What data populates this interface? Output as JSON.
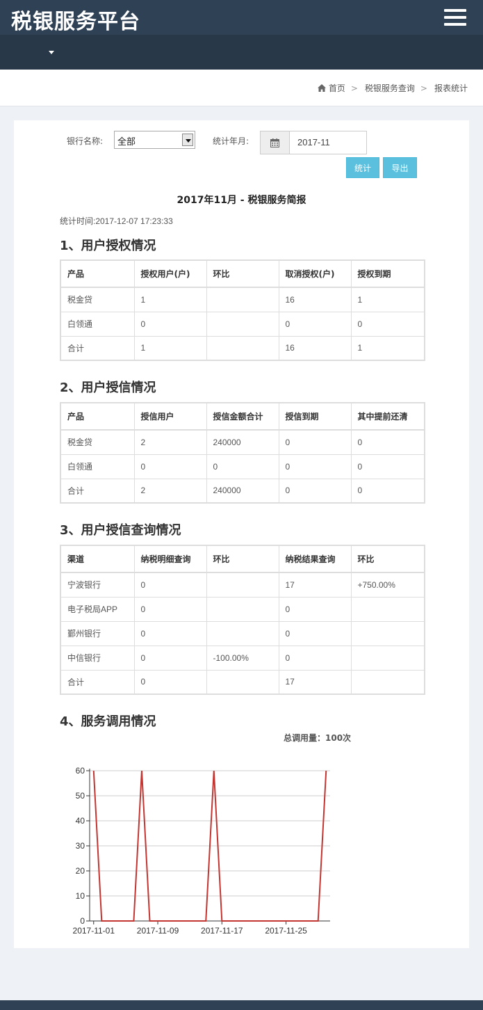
{
  "header": {
    "app_title": "税银服务平台",
    "menu_icon": "hamburger-icon"
  },
  "breadcrumb": {
    "items": [
      "首页",
      "税银服务查询",
      "报表统计"
    ],
    "home_icon": "home-icon"
  },
  "filters": {
    "bank_label": "银行名称:",
    "bank_value": "全部",
    "month_label": "统计年月:",
    "month_value": "2017-11",
    "calendar_icon": "calendar-icon",
    "stat_button": "统计",
    "export_button": "导出",
    "button_color": "#5bc0de"
  },
  "report": {
    "title": "2017年11月 - 税银服务简报",
    "stat_time": "统计时间:2017-12-07 17:23:33"
  },
  "sections": {
    "auth": {
      "title": "1、用户授权情况",
      "headers": [
        "产品",
        "授权用户(户)",
        "环比",
        "取消授权(户)",
        "授权到期"
      ],
      "rows": [
        [
          "税金贷",
          "1",
          "",
          "16",
          "1"
        ],
        [
          "白领通",
          "0",
          "",
          "0",
          "0"
        ],
        [
          "合计",
          "1",
          "",
          "16",
          "1"
        ]
      ]
    },
    "credit": {
      "title": "2、用户授信情况",
      "headers": [
        "产品",
        "授信用户",
        "授信金额合计",
        "授信到期",
        "其中提前还清"
      ],
      "rows": [
        [
          "税金贷",
          "2",
          "240000",
          "0",
          "0"
        ],
        [
          "白领通",
          "0",
          "0",
          "0",
          "0"
        ],
        [
          "合计",
          "2",
          "240000",
          "0",
          "0"
        ]
      ]
    },
    "query": {
      "title": "3、用户授信查询情况",
      "headers": [
        "渠道",
        "纳税明细查询",
        "环比",
        "纳税结果查询",
        "环比"
      ],
      "rows": [
        [
          "宁波银行",
          "0",
          "",
          "17",
          "+750.00%"
        ],
        [
          "电子税局APP",
          "0",
          "",
          "0",
          ""
        ],
        [
          "鄞州银行",
          "0",
          "",
          "0",
          ""
        ],
        [
          "中信银行",
          "0",
          "-100.00%",
          "0",
          ""
        ],
        [
          "合计",
          "0",
          "",
          "17",
          ""
        ]
      ]
    },
    "service": {
      "title": "4、服务调用情况",
      "total": "总调用量：100次"
    }
  },
  "chart_data": {
    "type": "line",
    "title": "",
    "xlabel": "",
    "ylabel": "",
    "ylim": [
      0,
      60
    ],
    "yticks": [
      "0",
      "10",
      "20",
      "30",
      "40",
      "50",
      "60"
    ],
    "xtick_labels": [
      "2017-11-01",
      "2017-11-09",
      "2017-11-17",
      "2017-11-25"
    ],
    "grid": true,
    "line_color": "#c23531",
    "series": [
      {
        "x": [
          "2017-11-01",
          "2017-11-02",
          "2017-11-03",
          "2017-11-04",
          "2017-11-05",
          "2017-11-06",
          "2017-11-07",
          "2017-11-08",
          "2017-11-09",
          "2017-11-10",
          "2017-11-11",
          "2017-11-12",
          "2017-11-13",
          "2017-11-14",
          "2017-11-15",
          "2017-11-16",
          "2017-11-17",
          "2017-11-18",
          "2017-11-19",
          "2017-11-20",
          "2017-11-21",
          "2017-11-22",
          "2017-11-23",
          "2017-11-24",
          "2017-11-25",
          "2017-11-26",
          "2017-11-27",
          "2017-11-28",
          "2017-11-29",
          "2017-11-30"
        ],
        "values": [
          60,
          0,
          0,
          0,
          0,
          0,
          60,
          0,
          0,
          0,
          0,
          0,
          0,
          0,
          0,
          60,
          0,
          0,
          0,
          0,
          0,
          0,
          0,
          0,
          0,
          0,
          0,
          0,
          0,
          60
        ]
      }
    ]
  }
}
